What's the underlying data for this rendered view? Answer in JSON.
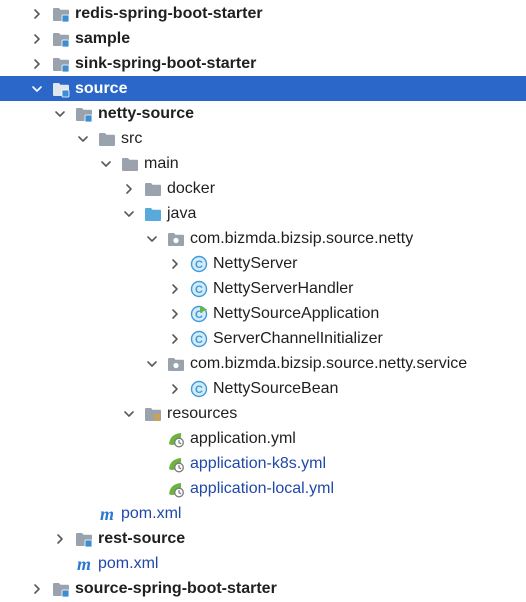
{
  "tree": {
    "rows": [
      {
        "label": "redis-spring-boot-starter",
        "depth": 0,
        "arrow": "right",
        "icon": "module-folder-icon",
        "bold": true,
        "selected": false,
        "link": false
      },
      {
        "label": "sample",
        "depth": 0,
        "arrow": "right",
        "icon": "module-folder-icon",
        "bold": true,
        "selected": false,
        "link": false
      },
      {
        "label": "sink-spring-boot-starter",
        "depth": 0,
        "arrow": "right",
        "icon": "module-folder-icon",
        "bold": true,
        "selected": false,
        "link": false
      },
      {
        "label": "source",
        "depth": 0,
        "arrow": "down",
        "icon": "module-folder-icon",
        "bold": true,
        "selected": true,
        "link": false
      },
      {
        "label": "netty-source",
        "depth": 1,
        "arrow": "down",
        "icon": "module-folder-icon",
        "bold": true,
        "selected": false,
        "link": false
      },
      {
        "label": "src",
        "depth": 2,
        "arrow": "down",
        "icon": "folder-icon",
        "bold": false,
        "selected": false,
        "link": false
      },
      {
        "label": "main",
        "depth": 3,
        "arrow": "down",
        "icon": "folder-icon",
        "bold": false,
        "selected": false,
        "link": false
      },
      {
        "label": "docker",
        "depth": 4,
        "arrow": "right",
        "icon": "folder-icon",
        "bold": false,
        "selected": false,
        "link": false
      },
      {
        "label": "java",
        "depth": 4,
        "arrow": "down",
        "icon": "source-folder-icon",
        "bold": false,
        "selected": false,
        "link": false
      },
      {
        "label": "com.bizmda.bizsip.source.netty",
        "depth": 5,
        "arrow": "down",
        "icon": "package-icon",
        "bold": false,
        "selected": false,
        "link": false
      },
      {
        "label": "NettyServer",
        "depth": 6,
        "arrow": "right",
        "icon": "class-icon",
        "bold": false,
        "selected": false,
        "link": false
      },
      {
        "label": "NettyServerHandler",
        "depth": 6,
        "arrow": "right",
        "icon": "class-icon",
        "bold": false,
        "selected": false,
        "link": false
      },
      {
        "label": "NettySourceApplication",
        "depth": 6,
        "arrow": "right",
        "icon": "spring-class-icon",
        "bold": false,
        "selected": false,
        "link": false
      },
      {
        "label": "ServerChannelInitializer",
        "depth": 6,
        "arrow": "right",
        "icon": "class-icon",
        "bold": false,
        "selected": false,
        "link": false
      },
      {
        "label": "com.bizmda.bizsip.source.netty.service",
        "depth": 5,
        "arrow": "down",
        "icon": "package-icon",
        "bold": false,
        "selected": false,
        "link": false
      },
      {
        "label": "NettySourceBean",
        "depth": 6,
        "arrow": "right",
        "icon": "class-icon",
        "bold": false,
        "selected": false,
        "link": false
      },
      {
        "label": "resources",
        "depth": 4,
        "arrow": "down",
        "icon": "resources-folder-icon",
        "bold": false,
        "selected": false,
        "link": false
      },
      {
        "label": "application.yml",
        "depth": 5,
        "arrow": "none",
        "icon": "spring-yml-icon",
        "bold": false,
        "selected": false,
        "link": false
      },
      {
        "label": "application-k8s.yml",
        "depth": 5,
        "arrow": "none",
        "icon": "spring-yml-icon",
        "bold": false,
        "selected": false,
        "link": true
      },
      {
        "label": "application-local.yml",
        "depth": 5,
        "arrow": "none",
        "icon": "spring-yml-icon",
        "bold": false,
        "selected": false,
        "link": true
      },
      {
        "label": "pom.xml",
        "depth": 2,
        "arrow": "none",
        "icon": "maven-icon",
        "bold": false,
        "selected": false,
        "link": true
      },
      {
        "label": "rest-source",
        "depth": 1,
        "arrow": "right",
        "icon": "module-folder-icon",
        "bold": true,
        "selected": false,
        "link": false
      },
      {
        "label": "pom.xml",
        "depth": 1,
        "arrow": "none",
        "icon": "maven-icon",
        "bold": false,
        "selected": false,
        "link": true
      },
      {
        "label": "source-spring-boot-starter",
        "depth": 0,
        "arrow": "right",
        "icon": "module-folder-icon",
        "bold": true,
        "selected": false,
        "link": false
      }
    ]
  },
  "colors": {
    "selection": "#2a67c9",
    "link": "#2148a8",
    "text": "#1f1f1f",
    "folder": "#9aa3ad",
    "source_folder": "#58a9dc",
    "module_marker": "#3d8fd4",
    "class_circle": "#3f9bd8",
    "spring": "#6db33f",
    "maven": "#2b79d0",
    "resources_marker": "#d9a23a"
  }
}
